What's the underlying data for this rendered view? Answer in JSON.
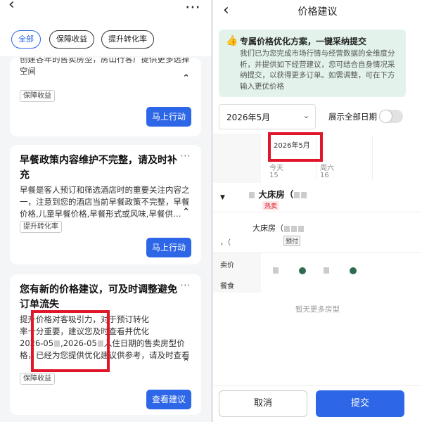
{
  "left": {
    "chips": [
      "全部",
      "保障收益",
      "提升转化率"
    ],
    "card1": {
      "body": "创建各年的售卖房型，房山行客广提供更多选择空间",
      "tag": "保障收益",
      "action": "马上行动"
    },
    "card2": {
      "title": "早餐政策内容维护不完整，请及时补充",
      "body": "早餐是客人预订和筛选酒店时的重要关注内容之一，注意到您的酒店当前早餐政策不完整，早餐价格,儿童早餐价格,早餐形式或风味,早餐供…",
      "tag": "提升转化率",
      "action": "马上行动"
    },
    "card3": {
      "title": "您有新的价格建议，可及时调整避免订单流失",
      "body_l1": "提升价格对客吸引力，对于预订转化",
      "body_l2": "率十分重要，建议您及时查看并优化",
      "body_l3a": "2026-05",
      "body_l3b": ",2026-05",
      "body_l3c": "入住日期的售卖房型价",
      "body_l4": "格，已经为您提供优化建议供参考，请及时查看",
      "tag": "保障收益",
      "action": "查看建议"
    }
  },
  "right": {
    "title": "价格建议",
    "banner": {
      "title": "专属价格优化方案，一键采纳提交",
      "body": "我们已为您完成市场行情与经营数据的全维度分析，并提供如下经营建议，您可结合自身情况采纳提交，以获得更多订单。如需调整，可在下方输入更优价格"
    },
    "month_select": "2026年5月",
    "show_all_dates": "展示全部日期",
    "calendar": {
      "month": "2026年5月",
      "days": [
        {
          "label": "今天",
          "num": "15"
        },
        {
          "label": "周六",
          "num": "16"
        }
      ]
    },
    "room": {
      "name": "大床房（",
      "badge": "热卖"
    },
    "rate": {
      "name": "大床房（",
      "prefix": "，（",
      "prepay": "预付"
    },
    "rows": {
      "price": "卖价",
      "meal": "餐食"
    },
    "no_more": "暂无更多房型",
    "cancel": "取消",
    "submit": "提交"
  },
  "colors": {
    "primary": "#2d66e6",
    "highlight": "#e0162a",
    "banner_bg": "#e3f3ec"
  }
}
